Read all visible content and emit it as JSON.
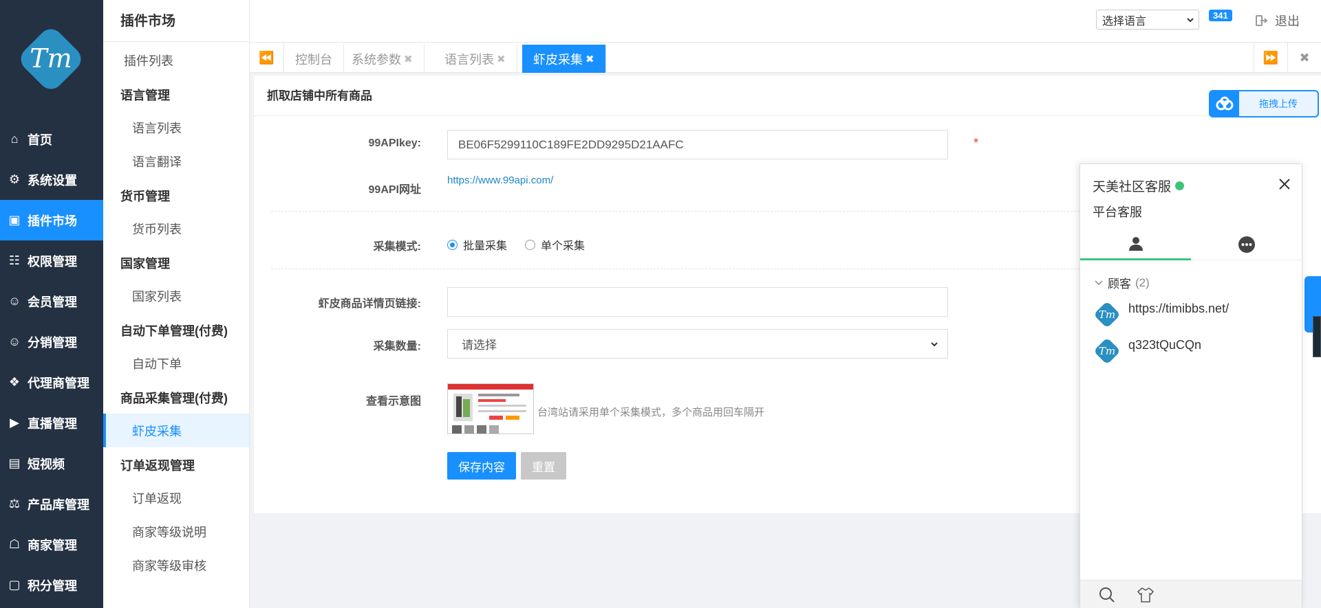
{
  "nav": {
    "items": [
      {
        "label": "首页",
        "icon": "home-icon"
      },
      {
        "label": "系统设置",
        "icon": "gear-icon"
      },
      {
        "label": "插件市场",
        "icon": "plugin-icon",
        "active": true
      },
      {
        "label": "权限管理",
        "icon": "sitemap-icon"
      },
      {
        "label": "会员管理",
        "icon": "users-icon"
      },
      {
        "label": "分销管理",
        "icon": "users-icon"
      },
      {
        "label": "代理商管理",
        "icon": "cubes-icon"
      },
      {
        "label": "直播管理",
        "icon": "video-icon"
      },
      {
        "label": "短视频",
        "icon": "film-icon"
      },
      {
        "label": "产品库管理",
        "icon": "balance-icon"
      },
      {
        "label": "商家管理",
        "icon": "bank-icon"
      },
      {
        "label": "积分管理",
        "icon": "points-icon"
      }
    ]
  },
  "sub": {
    "title": "插件市场",
    "plugin_list": "插件列表",
    "groups": [
      {
        "title": "语言管理",
        "items": [
          "语言列表",
          "语言翻译"
        ]
      },
      {
        "title": "货币管理",
        "items": [
          "货币列表"
        ]
      },
      {
        "title": "国家管理",
        "items": [
          "国家列表"
        ]
      },
      {
        "title": "自动下单管理(付费)",
        "items": [
          "自动下单"
        ]
      },
      {
        "title": "商品采集管理(付费)",
        "items": [
          "虾皮采集"
        ]
      },
      {
        "title": "订单返现管理",
        "items": [
          "订单返现",
          "商家等级说明",
          "商家等级审核"
        ]
      }
    ]
  },
  "header": {
    "lang_placeholder": "选择语言",
    "badge": "341",
    "logout": "退出"
  },
  "tabs": [
    {
      "label": "控制台"
    },
    {
      "label": "系统参数",
      "closable": true
    },
    {
      "label": "语言列表",
      "closable": true
    },
    {
      "label": "虾皮采集",
      "closable": true,
      "active": true
    }
  ],
  "form": {
    "title": "抓取店铺中所有商品",
    "apikey_label": "99APIkey:",
    "apikey_value": "BE06F5299110C189FE2DD9295D21AAFC",
    "url_label": "99API网址",
    "url_value": "https://www.99api.com/",
    "mode_label": "采集模式:",
    "mode_options": [
      "批量采集",
      "单个采集"
    ],
    "mode_selected": "批量采集",
    "link_label": "虾皮商品详情页链接:",
    "link_value": "",
    "count_label": "采集数量:",
    "count_value": "请选择",
    "preview_label": "查看示意图",
    "hint": "台湾站请采用单个采集模式，多个商品用回车隔开",
    "save": "保存内容",
    "reset": "重置",
    "required_mark": "*"
  },
  "upload": {
    "label": "拖拽上传"
  },
  "chat": {
    "title": "天美社区客服",
    "subtitle": "平台客服",
    "group_label": "顾客",
    "group_count": "(2)",
    "customers": [
      "https://timibbs.net/",
      "q323tQuCQn"
    ]
  },
  "colors": {
    "accent": "#1890ff",
    "nav_bg": "#233142",
    "online": "#3ec47a"
  }
}
